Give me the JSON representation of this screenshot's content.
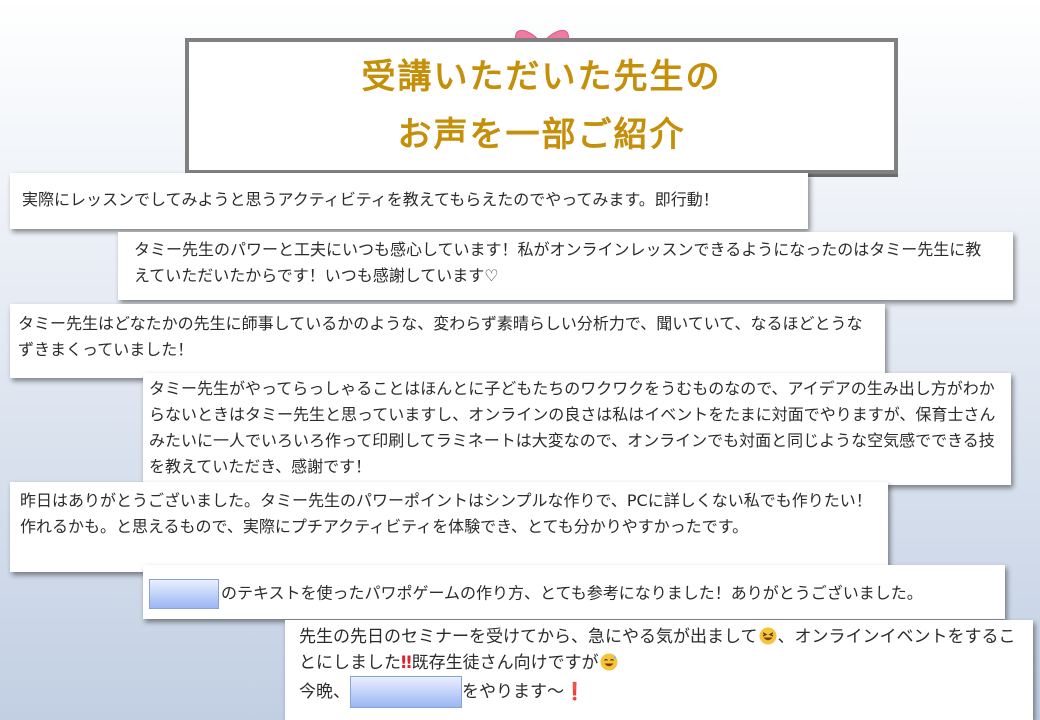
{
  "title": {
    "line1": "受講いただいた先生の",
    "line2": "お声を一部ご紹介"
  },
  "colors": {
    "title_text": "#c58f0a",
    "bow": "#f07aa0",
    "redaction": "#9bb6f4"
  },
  "icons": {
    "bow": "bow-ribbon-icon",
    "laugh": "grinning-squint-face-emoji",
    "sweat": "grinning-sweat-face-emoji",
    "double_exclamation": "double-exclamation-mark",
    "exclamation": "red-exclamation-mark"
  },
  "testimonials": {
    "t1": "実際にレッスンでしてみようと思うアクティビティを教えてもらえたのでやってみます。即行動！",
    "t2": "タミー先生のパワーと工夫にいつも感心しています！私がオンラインレッスンできるようになったのはタミー先生に教えていただいたからです！いつも感謝しています♡",
    "t3": "タミー先生はどなたかの先生に師事しているかのような、変わらず素晴らしい分析力で、聞いていて、なるほどとうなずきまくっていました！",
    "t4": "タミー先生がやってらっしゃることはほんとに子どもたちのワクワクをうむものなので、アイデアの生み出し方がわからないときはタミー先生と思っていますし、オンラインの良さは私はイベントをたまに対面でやりますが、保育士さんみたいに一人でいろいろ作って印刷してラミネートは大変なので、オンラインでも対面と同じような空気感でできる技を教えていただき、感謝です！",
    "t5": "昨日はありがとうございました。タミー先生のパワーポイントはシンプルな作りで、PCに詳しくない私でも作りたい！作れるかも。と思えるもので、実際にプチアクティビティを体験でき、とても分かりやすかったです。",
    "t6": "のテキストを使ったパワポゲームの作り方、とても参考になりました！ありがとうございました。",
    "t7": {
      "part1": "先生の先日のセミナーを受けてから、急にやる気が出まして",
      "part2": "、オンラインイベントをすることにしました",
      "part3": "既存生徒さん向けですが",
      "line3_prefix": "今晩、",
      "line3_suffix": "をやります〜"
    }
  }
}
